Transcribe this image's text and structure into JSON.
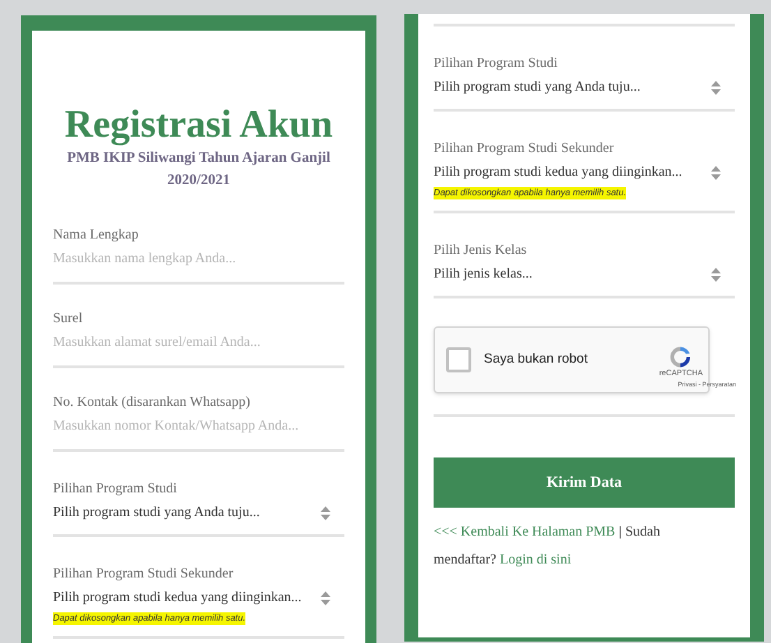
{
  "left_panel": {
    "title": "Registrasi Akun",
    "subtitle": "PMB IKIP Siliwangi Tahun Ajaran Ganjil 2020/2021",
    "fields": [
      {
        "kind": "text",
        "label": "Nama Lengkap",
        "placeholder": "Masukkan nama lengkap Anda..."
      },
      {
        "kind": "text",
        "label": "Surel",
        "placeholder": "Masukkan alamat surel/email Anda..."
      },
      {
        "kind": "text",
        "label": "No. Kontak (disarankan Whatsapp)",
        "placeholder": "Masukkan nomor Kontak/Whatsapp Anda..."
      },
      {
        "kind": "select",
        "label": "Pilihan Program Studi",
        "value": "Pilih program studi yang Anda tuju..."
      },
      {
        "kind": "select",
        "label": "Pilihan Program Studi Sekunder",
        "value": "Pilih program studi kedua yang diinginkan...",
        "hint": "Dapat dikosongkan apabila hanya memilih satu."
      }
    ]
  },
  "right_panel": {
    "fields": [
      {
        "kind": "select",
        "label": "Pilihan Program Studi",
        "value": "Pilih program studi yang Anda tuju..."
      },
      {
        "kind": "select",
        "label": "Pilihan Program Studi Sekunder",
        "value": "Pilih program studi kedua yang diinginkan...",
        "hint": "Dapat dikosongkan apabila hanya memilih satu."
      },
      {
        "kind": "select",
        "label": "Pilih Jenis Kelas",
        "value": "Pilih jenis kelas..."
      }
    ],
    "captcha": {
      "label": "Saya bukan robot",
      "checked": false,
      "brand": "reCAPTCHA",
      "terms": "Privasi - Persyaratan"
    },
    "submit": "Kirim Data",
    "footer": {
      "back_link": "<<< Kembali Ke Halaman PMB",
      "separator": "|",
      "question": "Sudah mendaftar?",
      "login_link": "Login di sini"
    }
  }
}
